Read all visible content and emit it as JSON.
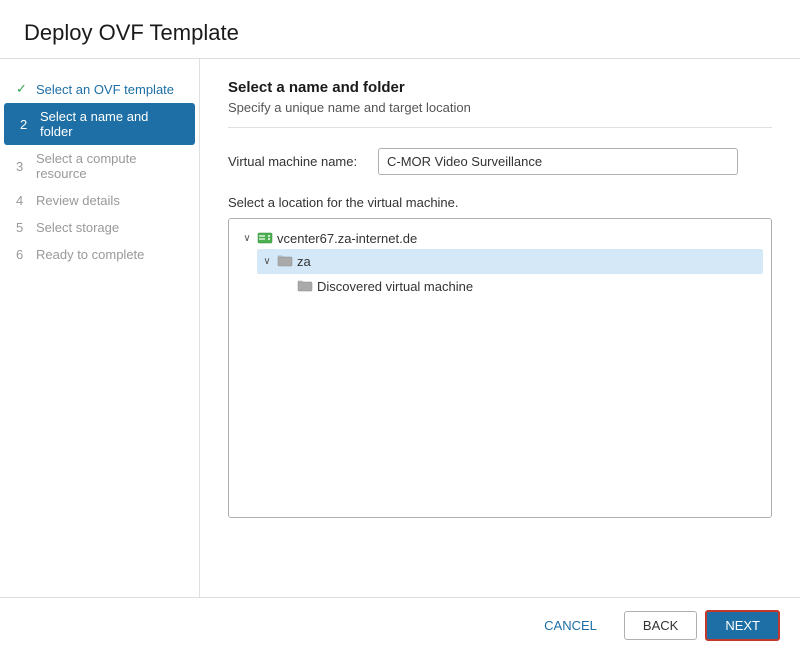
{
  "dialog": {
    "title": "Deploy OVF Template"
  },
  "sidebar": {
    "items": [
      {
        "id": "step1",
        "number": "1",
        "label": "Select an OVF template",
        "state": "completed"
      },
      {
        "id": "step2",
        "number": "2",
        "label": "Select a name and folder",
        "state": "active"
      },
      {
        "id": "step3",
        "number": "3",
        "label": "Select a compute resource",
        "state": "disabled"
      },
      {
        "id": "step4",
        "number": "4",
        "label": "Review details",
        "state": "disabled"
      },
      {
        "id": "step5",
        "number": "5",
        "label": "Select storage",
        "state": "disabled"
      },
      {
        "id": "step6",
        "number": "6",
        "label": "Ready to complete",
        "state": "disabled"
      }
    ]
  },
  "main": {
    "section_title": "Select a name and folder",
    "section_subtitle": "Specify a unique name and target location",
    "vm_name_label": "Virtual machine name:",
    "vm_name_value": "C-MOR Video Surveillance",
    "location_label": "Select a location for the virtual machine.",
    "tree": {
      "root": {
        "label": "vcenter67.za-internet.de",
        "expanded": true,
        "children": [
          {
            "label": "za",
            "expanded": true,
            "selected": true,
            "children": [
              {
                "label": "Discovered virtual machine",
                "expanded": false,
                "children": []
              }
            ]
          }
        ]
      }
    }
  },
  "footer": {
    "cancel_label": "CANCEL",
    "back_label": "BACK",
    "next_label": "NEXT"
  }
}
